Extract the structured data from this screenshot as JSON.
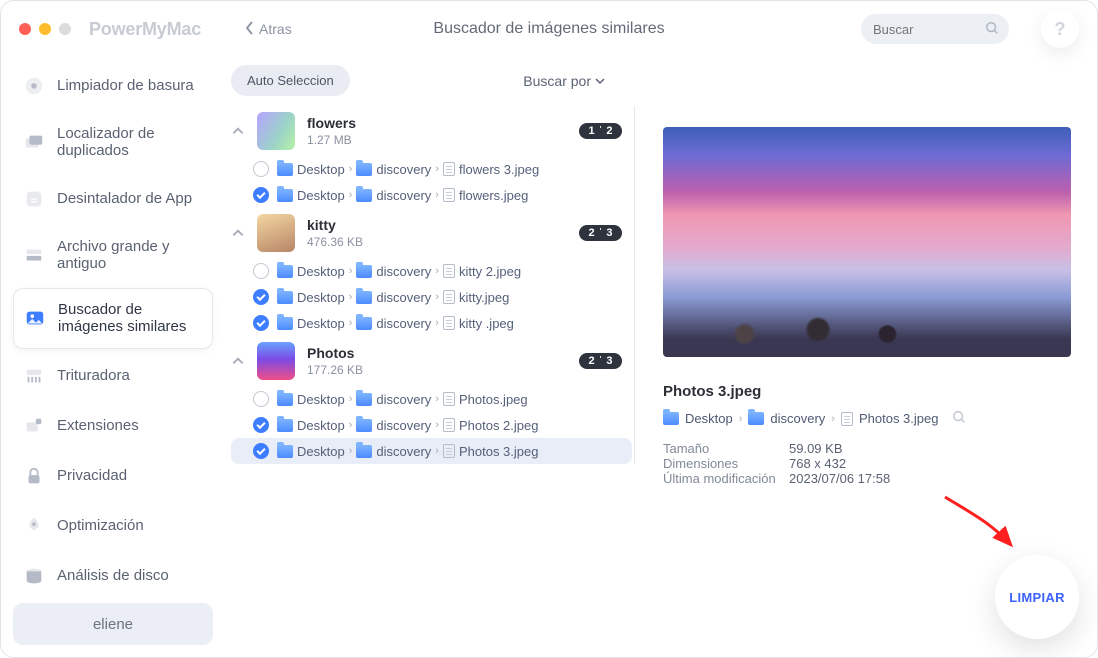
{
  "app": {
    "title": "PowerMyMac",
    "back_label": "Atras",
    "page_title": "Buscador de imágenes similares",
    "search_placeholder": "Buscar",
    "help_label": "?"
  },
  "sidebar": {
    "items": [
      {
        "label": "Limpiador de basura"
      },
      {
        "label": "Localizador de duplicados"
      },
      {
        "label": "Desintalador de App"
      },
      {
        "label": "Archivo grande y antiguo"
      },
      {
        "label": "Buscador de imágenes similares"
      },
      {
        "label": "Trituradora"
      },
      {
        "label": "Extensiones"
      },
      {
        "label": "Privacidad"
      },
      {
        "label": "Optimización"
      },
      {
        "label": "Análisis de disco"
      }
    ],
    "user": "eliene"
  },
  "toolbar": {
    "auto_select": "Auto Seleccion",
    "sort_label": "Buscar por"
  },
  "groups": [
    {
      "name": "flowers",
      "size": "1.27 MB",
      "badge": "1 ˈ 2",
      "files": [
        {
          "checked": false,
          "path": [
            "Desktop",
            "discovery"
          ],
          "name": "flowers 3.jpeg"
        },
        {
          "checked": true,
          "path": [
            "Desktop",
            "discovery"
          ],
          "name": "flowers.jpeg"
        }
      ]
    },
    {
      "name": "kitty",
      "size": "476.36 KB",
      "badge": "2 ˈ 3",
      "files": [
        {
          "checked": false,
          "path": [
            "Desktop",
            "discovery"
          ],
          "name": "kitty 2.jpeg"
        },
        {
          "checked": true,
          "path": [
            "Desktop",
            "discovery"
          ],
          "name": "kitty.jpeg"
        },
        {
          "checked": true,
          "path": [
            "Desktop",
            "discovery"
          ],
          "name": "kitty .jpeg"
        }
      ]
    },
    {
      "name": "Photos",
      "size": "177.26 KB",
      "badge": "2 ˈ 3",
      "files": [
        {
          "checked": false,
          "path": [
            "Desktop",
            "discovery"
          ],
          "name": "Photos.jpeg"
        },
        {
          "checked": true,
          "path": [
            "Desktop",
            "discovery"
          ],
          "name": "Photos 2.jpeg"
        },
        {
          "checked": true,
          "path": [
            "Desktop",
            "discovery"
          ],
          "name": "Photos 3.jpeg",
          "selected": true
        }
      ]
    }
  ],
  "preview": {
    "title": "Photos 3.jpeg",
    "path": [
      "Desktop",
      "discovery",
      "Photos 3.jpeg"
    ],
    "meta": {
      "size_label": "Tamaño",
      "size_value": "59.09 KB",
      "dim_label": "Dimensiones",
      "dim_value": "768 x 432",
      "mod_label": "Última modificación",
      "mod_value": "2023/07/06 17:58"
    },
    "clean_label": "LIMPIAR"
  }
}
